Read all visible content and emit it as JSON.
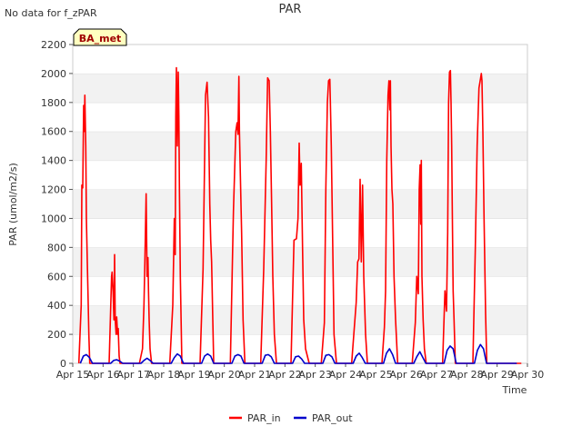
{
  "chart_data": {
    "type": "line",
    "title": "PAR",
    "no_data_note": "No data for f_zPAR",
    "badge": "BA_met",
    "xlabel": "Time",
    "ylabel": "PAR (umol/m2/s)",
    "ylim": [
      0,
      2200
    ],
    "xlim": [
      15,
      30
    ],
    "yticks": [
      0,
      200,
      400,
      600,
      800,
      1000,
      1200,
      1400,
      1600,
      1800,
      2000,
      2200
    ],
    "xticks": [
      15,
      16,
      17,
      18,
      19,
      20,
      21,
      22,
      23,
      24,
      25,
      26,
      27,
      28,
      29,
      30
    ],
    "xtick_labels": [
      "Apr 15",
      "Apr 16",
      "Apr 17",
      "Apr 18",
      "Apr 19",
      "Apr 20",
      "Apr 21",
      "Apr 22",
      "Apr 23",
      "Apr 24",
      "Apr 25",
      "Apr 26",
      "Apr 27",
      "Apr 28",
      "Apr 29",
      "Apr 30"
    ],
    "grid": "horizontal bands",
    "legend": "bottom-center",
    "series": [
      {
        "name": "PAR_in",
        "color": "#ff0000",
        "x": [
          15.2,
          15.28,
          15.3,
          15.33,
          15.36,
          15.38,
          15.4,
          15.43,
          15.45,
          15.48,
          15.5,
          15.53,
          15.56,
          15.58,
          15.6,
          15.65,
          15.72,
          15.8,
          16.2,
          16.28,
          16.3,
          16.33,
          16.36,
          16.38,
          16.4,
          16.43,
          16.45,
          16.48,
          16.5,
          16.53,
          16.56,
          16.58,
          16.62,
          16.66,
          16.72,
          16.8,
          17.2,
          17.3,
          17.35,
          17.38,
          17.42,
          17.45,
          17.48,
          17.5,
          17.52,
          17.55,
          17.6,
          17.65,
          17.72,
          17.8,
          18.2,
          18.3,
          18.35,
          18.38,
          18.4,
          18.42,
          18.45,
          18.48,
          18.5,
          18.52,
          18.55,
          18.6,
          18.68,
          18.8,
          19.2,
          19.3,
          19.38,
          19.43,
          19.48,
          19.52,
          19.55,
          19.58,
          19.62,
          19.65,
          19.72,
          19.8,
          20.2,
          20.3,
          20.38,
          20.42,
          20.45,
          20.48,
          20.5,
          20.53,
          20.57,
          20.62,
          20.68,
          20.8,
          21.2,
          21.3,
          21.38,
          21.43,
          21.48,
          21.52,
          21.56,
          21.6,
          21.65,
          21.72,
          21.8,
          22.2,
          22.3,
          22.38,
          22.43,
          22.47,
          22.5,
          22.54,
          22.58,
          22.62,
          22.68,
          22.8,
          23.2,
          23.3,
          23.35,
          23.4,
          23.44,
          23.48,
          23.5,
          23.53,
          23.57,
          23.62,
          23.7,
          23.8,
          24.2,
          24.28,
          24.35,
          24.4,
          24.44,
          24.48,
          24.52,
          24.56,
          24.6,
          24.66,
          24.72,
          24.8,
          25.2,
          25.28,
          25.32,
          25.36,
          25.4,
          25.43,
          25.46,
          25.48,
          25.5,
          25.53,
          25.56,
          25.6,
          25.65,
          25.72,
          25.8,
          26.2,
          26.3,
          26.35,
          26.4,
          26.43,
          26.46,
          26.48,
          26.5,
          26.52,
          26.56,
          26.6,
          26.66,
          26.72,
          26.8,
          27.2,
          27.28,
          27.33,
          27.37,
          27.4,
          27.43,
          27.46,
          27.48,
          27.5,
          27.52,
          27.55,
          27.58,
          27.62,
          27.68,
          27.75,
          27.8,
          28.2,
          28.28,
          28.34,
          28.4,
          28.45,
          28.48,
          28.5,
          28.53,
          28.57,
          28.62,
          28.66,
          28.72,
          28.8,
          29.2,
          29.3,
          29.36,
          29.42,
          29.47,
          29.5,
          29.54,
          29.58,
          29.62,
          29.65,
          29.68,
          29.72,
          29.8
        ],
        "y": [
          0,
          400,
          1230,
          1210,
          1780,
          1600,
          1850,
          1500,
          1000,
          700,
          500,
          200,
          0,
          0,
          0,
          0,
          0,
          0,
          0,
          600,
          630,
          500,
          300,
          750,
          300,
          200,
          320,
          200,
          240,
          50,
          0,
          0,
          0,
          0,
          0,
          0,
          0,
          100,
          400,
          700,
          1170,
          600,
          730,
          500,
          300,
          100,
          0,
          0,
          0,
          0,
          0,
          400,
          1000,
          750,
          1700,
          2040,
          1500,
          2010,
          1700,
          1200,
          600,
          0,
          0,
          0,
          0,
          650,
          1850,
          1940,
          1700,
          1100,
          850,
          700,
          300,
          0,
          0,
          0,
          0,
          1050,
          1600,
          1660,
          1580,
          1980,
          1600,
          1300,
          900,
          300,
          0,
          0,
          0,
          650,
          1400,
          1970,
          1950,
          1600,
          1100,
          600,
          200,
          0,
          0,
          0,
          850,
          860,
          1000,
          1520,
          1230,
          1380,
          800,
          300,
          100,
          0,
          0,
          280,
          1200,
          1800,
          1950,
          1960,
          1800,
          1500,
          900,
          200,
          0,
          0,
          0,
          220,
          420,
          700,
          720,
          1270,
          700,
          1230,
          600,
          200,
          0,
          0,
          0,
          250,
          500,
          1400,
          1850,
          1950,
          1750,
          1950,
          1500,
          1200,
          1100,
          600,
          300,
          0,
          0,
          0,
          280,
          600,
          480,
          1200,
          1370,
          960,
          1400,
          600,
          300,
          100,
          0,
          0,
          0,
          0,
          500,
          360,
          900,
          1800,
          2010,
          2020,
          1800,
          1500,
          1100,
          500,
          300,
          0,
          0,
          0,
          0,
          0,
          800,
          1500,
          1900,
          1960,
          2000,
          1950,
          1600,
          1000,
          340,
          0,
          0,
          0,
          0,
          0,
          0,
          0,
          0,
          0,
          0,
          0,
          0,
          0,
          0,
          0,
          0
        ],
        "note": "series end truncated on last day"
      },
      {
        "name": "PAR_out",
        "color": "#0000cc",
        "x": [
          15.25,
          15.35,
          15.45,
          15.55,
          15.65,
          16.25,
          16.35,
          16.45,
          16.55,
          16.65,
          17.25,
          17.35,
          17.45,
          17.55,
          17.65,
          18.25,
          18.35,
          18.45,
          18.55,
          18.65,
          19.25,
          19.35,
          19.45,
          19.55,
          19.65,
          20.25,
          20.35,
          20.45,
          20.55,
          20.65,
          21.25,
          21.35,
          21.45,
          21.55,
          21.65,
          22.25,
          22.35,
          22.45,
          22.55,
          22.65,
          23.25,
          23.35,
          23.45,
          23.55,
          23.65,
          24.25,
          24.35,
          24.45,
          24.55,
          24.65,
          25.25,
          25.35,
          25.45,
          25.55,
          25.65,
          26.25,
          26.35,
          26.45,
          26.55,
          26.65,
          27.25,
          27.35,
          27.45,
          27.55,
          27.65,
          28.25,
          28.35,
          28.45,
          28.55,
          28.65,
          29.25,
          29.35,
          29.45,
          29.55,
          29.65
        ],
        "y": [
          0,
          50,
          60,
          40,
          0,
          0,
          20,
          25,
          15,
          0,
          0,
          20,
          35,
          20,
          0,
          0,
          40,
          65,
          50,
          0,
          0,
          50,
          65,
          50,
          0,
          0,
          50,
          60,
          50,
          0,
          0,
          55,
          60,
          45,
          0,
          0,
          45,
          50,
          30,
          0,
          0,
          55,
          60,
          45,
          0,
          0,
          50,
          70,
          40,
          0,
          0,
          70,
          100,
          60,
          0,
          0,
          45,
          80,
          40,
          0,
          0,
          90,
          120,
          100,
          0,
          0,
          90,
          130,
          100,
          0,
          0,
          0,
          0,
          0,
          0
        ]
      }
    ]
  }
}
